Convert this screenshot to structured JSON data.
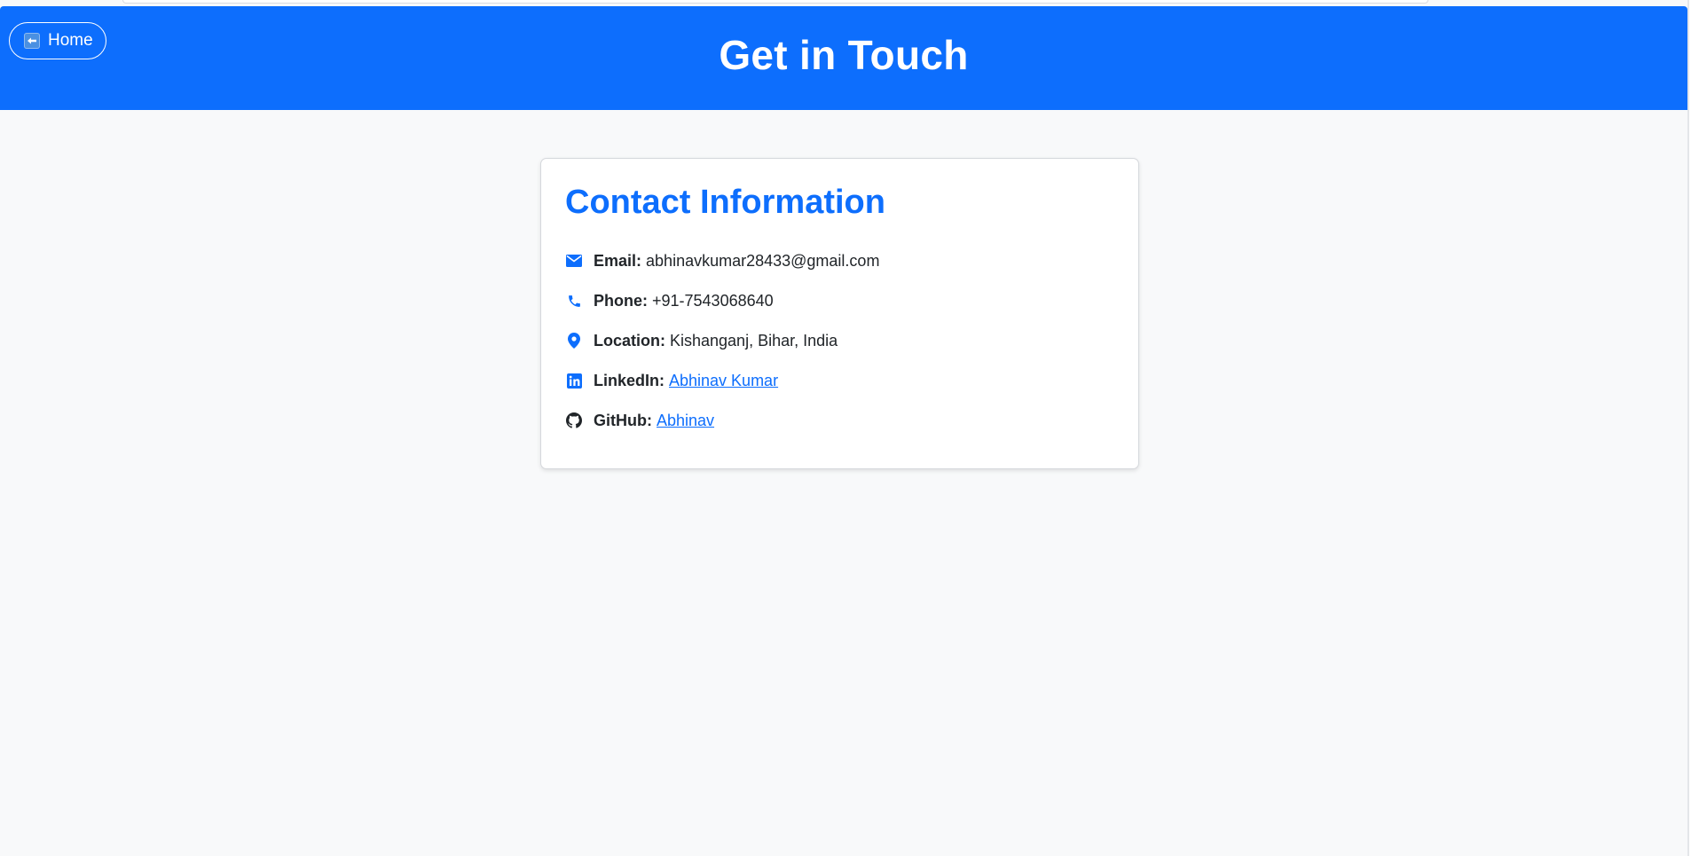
{
  "header": {
    "home_label": "Home",
    "title": "Get in Touch"
  },
  "contact": {
    "heading": "Contact Information",
    "rows": [
      {
        "icon": "envelope-icon",
        "label": "Email:",
        "value": "abhinavkumar28433@gmail.com",
        "is_link": false
      },
      {
        "icon": "phone-icon",
        "label": "Phone:",
        "value": "+91-7543068640",
        "is_link": false
      },
      {
        "icon": "location-pin-icon",
        "label": "Location:",
        "value": "Kishanganj, Bihar, India",
        "is_link": false
      },
      {
        "icon": "linkedin-icon",
        "label": "LinkedIn:",
        "value": "Abhinav Kumar",
        "is_link": true
      },
      {
        "icon": "github-icon",
        "label": "GitHub:",
        "value": "Abhinav",
        "is_link": true
      }
    ]
  },
  "colors": {
    "primary": "#0d6efd",
    "background": "#f8f9fa",
    "text": "#212529",
    "github_icon": "#212529"
  }
}
